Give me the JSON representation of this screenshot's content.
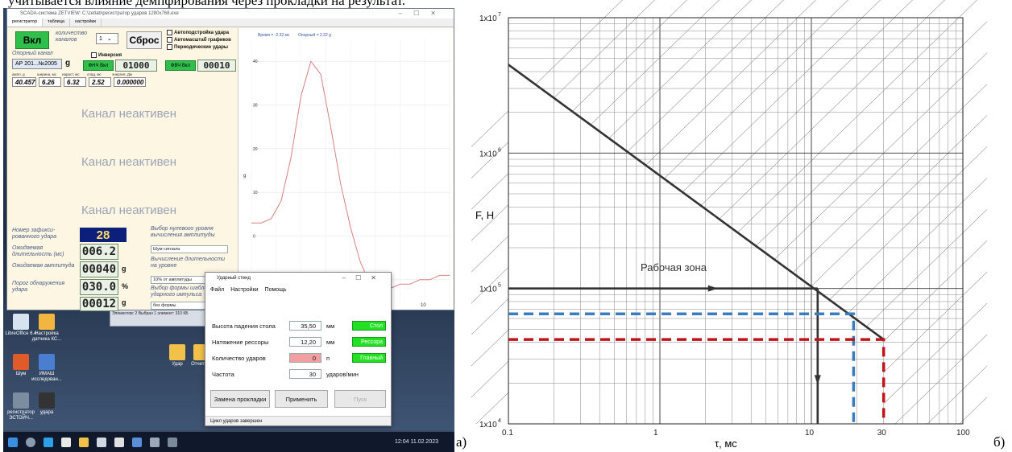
{
  "caption_top": "учитывается влияние демпфирования через прокладки на результат.",
  "label_a": "а)",
  "label_b": "б)",
  "scada": {
    "title": "SCADA-система ZETVIEW: C:\\zetlab\\регистратор ударов 1280x768.exe",
    "tabs": [
      "регистратор",
      "таблица",
      "настройки"
    ],
    "btn_on": "Вкл",
    "channels_label": "количество каналов",
    "channels_value": "1",
    "btn_reset": "Сброс",
    "ref_channel_label": "Опорный канал",
    "ref_channel_value": "АР 201...№2005",
    "unit_g": "g",
    "inverse_label": "Инверсия",
    "check_autosetup": "Автоподстройка удара",
    "check_autoscale": "Автомасштаб графиков",
    "check_periodic": "Периодические удары",
    "lpf_btn": "ФНЧ Вкл",
    "lpf_value": "01000",
    "hpf_btn": "ФВЧ Вкл",
    "hpf_value": "00010",
    "param_headers": [
      "ампл. g",
      "ширина, мс",
      "нараст. мс",
      "спад, мс",
      "энергия, Дж"
    ],
    "param_values": [
      "40.457",
      "6.26",
      "6.32",
      "2.52",
      "0.000000"
    ],
    "inactive": [
      "Канал неактивен",
      "Канал неактивен",
      "Канал неактивен"
    ],
    "fixed_hit_label": "Номер зафикси-рованного удара",
    "fixed_hit_value": "28",
    "expected_dur_label": "Ожидаемая длительность (мс)",
    "expected_dur_value": "006.2",
    "expected_amp_label": "Ожидаемая амплитуда",
    "expected_amp_value": "00040",
    "threshold_label": "Порог обнаружения удара",
    "threshold_value": "030.0",
    "percent": "%",
    "last_value": "00012",
    "zero_level_label": "Выбор нулевого уровня вычисления амплитуды",
    "zero_level_value": "Шум сигнала",
    "duration_calc_label": "Вычисление длительности на уровне",
    "duration_calc_value": "10% от амплитуды",
    "shape_label": "Выбор формы шаблона ударного импульса",
    "shape_value": "без формы",
    "plot_header_time": "Время = -2.32 мс",
    "plot_header_ref": "Опорный = 2.32 g",
    "plot_yticks": [
      "40",
      "30",
      "20",
      "10",
      "0",
      "-10"
    ],
    "plot_xtick": "10",
    "plot_ylabel": "g"
  },
  "desktop": {
    "icons": [
      "LibreOffice 6.4",
      "Настройка датчика КС...",
      "Шум",
      "ИМАШ исследован...",
      "регистратор ЭСТОЙЧ...",
      "удара"
    ],
    "folders": [
      "Удар",
      "Отчеты 2"
    ],
    "mini_window": "Элементов: 2   Выбран 1 элемент: 310 КБ",
    "tray": "12:04\n11.02.2023"
  },
  "stand": {
    "title": "Ударный стенд",
    "menu": [
      "Файл",
      "Настройки",
      "Помощь"
    ],
    "rows": [
      {
        "label": "Высота падения стола",
        "value": "35,50",
        "unit": "мм",
        "state": "Стол"
      },
      {
        "label": "Натяжение рессоры",
        "value": "12,20",
        "unit": "мм",
        "state": "Рессора"
      },
      {
        "label": "Количество ударов",
        "value": "0",
        "unit": "п",
        "state": "Главный"
      },
      {
        "label": "Частота",
        "value": "30",
        "unit": "ударов/мин",
        "state": ""
      }
    ],
    "btn_replace": "Замена прокладки",
    "btn_apply": "Применить",
    "btn_start": "Пуск",
    "status": "Цикл ударов завершен"
  },
  "chart_data": [
    {
      "type": "line",
      "title": "",
      "xlabel": "",
      "ylabel": "g",
      "ylim": [
        -15,
        45
      ],
      "series": [
        {
          "x": [
            0,
            1,
            2,
            3,
            4,
            5,
            6,
            7,
            8,
            9,
            10,
            11,
            12,
            13,
            14,
            15,
            16,
            17,
            18,
            19,
            20
          ],
          "values": [
            3,
            3,
            4,
            8,
            18,
            32,
            40,
            37,
            25,
            12,
            2,
            -6,
            -11,
            -12,
            -12,
            -11,
            -11,
            -10,
            -10,
            -9,
            -9
          ]
        }
      ]
    },
    {
      "type": "line",
      "scale": "log-log",
      "xlabel": "τ, мс",
      "ylabel": "F, Н",
      "xlim": [
        0.1,
        100
      ],
      "ylim": [
        10000,
        10000000
      ],
      "xticks": [
        "0.1",
        "1",
        "10",
        "30",
        "100"
      ],
      "yticks": [
        "1x10",
        "1x10",
        "1x10",
        "1x10"
      ],
      "ytick_exponents": [
        "4",
        "5",
        "6",
        "7"
      ],
      "annotation": "Рабочая зона",
      "series": [
        {
          "x": [
            0.1,
            30
          ],
          "values": [
            4500000,
            42000
          ],
          "color": "#333333"
        },
        {
          "x": [
            0.1,
            11
          ],
          "values": [
            100000,
            100000
          ],
          "color": "#333333"
        },
        {
          "x": [
            11,
            11
          ],
          "values": [
            100000,
            10000
          ],
          "color": "#333333"
        },
        {
          "x": [
            0.1,
            19,
            19
          ],
          "values": [
            65000,
            65000,
            10000
          ],
          "color": "#3a7cc0"
        },
        {
          "x": [
            0.1,
            30,
            30
          ],
          "values": [
            42000,
            42000,
            10000
          ],
          "color": "#c0141c"
        }
      ]
    }
  ]
}
